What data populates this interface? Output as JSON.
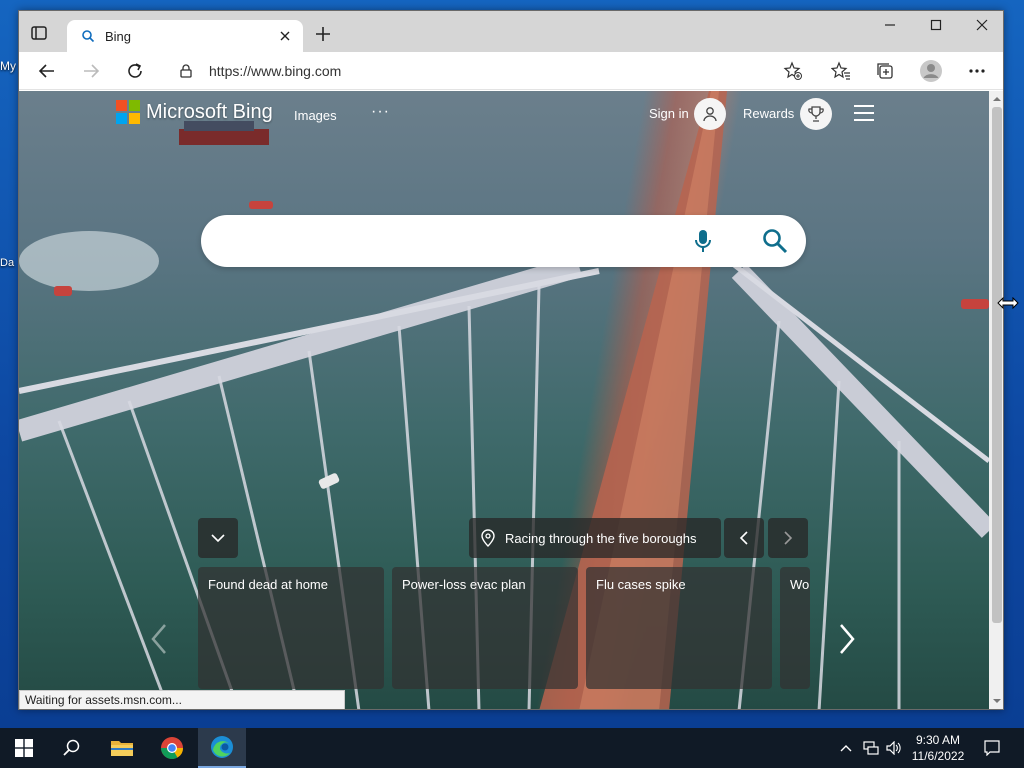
{
  "desktop": {
    "icon_label_1": "My",
    "icon_label_2": "Da"
  },
  "browser": {
    "tab": {
      "title": "Bing",
      "favicon": "search-icon"
    },
    "address": {
      "url": "https://www.bing.com"
    },
    "window_controls": [
      "minimize",
      "maximize",
      "close"
    ],
    "status_text": "Waiting for assets.msn.com..."
  },
  "bing": {
    "logo_text": "Microsoft Bing",
    "logo_colors": [
      "#f25022",
      "#7fba00",
      "#00a4ef",
      "#ffb900"
    ],
    "nav": {
      "images": "Images",
      "more": "···"
    },
    "sign_in": "Sign in",
    "rewards": "Rewards",
    "search": {
      "value": ""
    },
    "image_title": "Racing through the five boroughs",
    "news_cards": [
      {
        "title": "Found dead at home"
      },
      {
        "title": "Power-loss evac plan"
      },
      {
        "title": "Flu cases spike"
      },
      {
        "title": "Wo"
      }
    ]
  },
  "taskbar": {
    "apps": [
      "start-button",
      "search-icon",
      "file-explorer-icon",
      "chrome-icon",
      "edge-icon"
    ],
    "time": "9:30 AM",
    "date": "11/6/2022"
  }
}
